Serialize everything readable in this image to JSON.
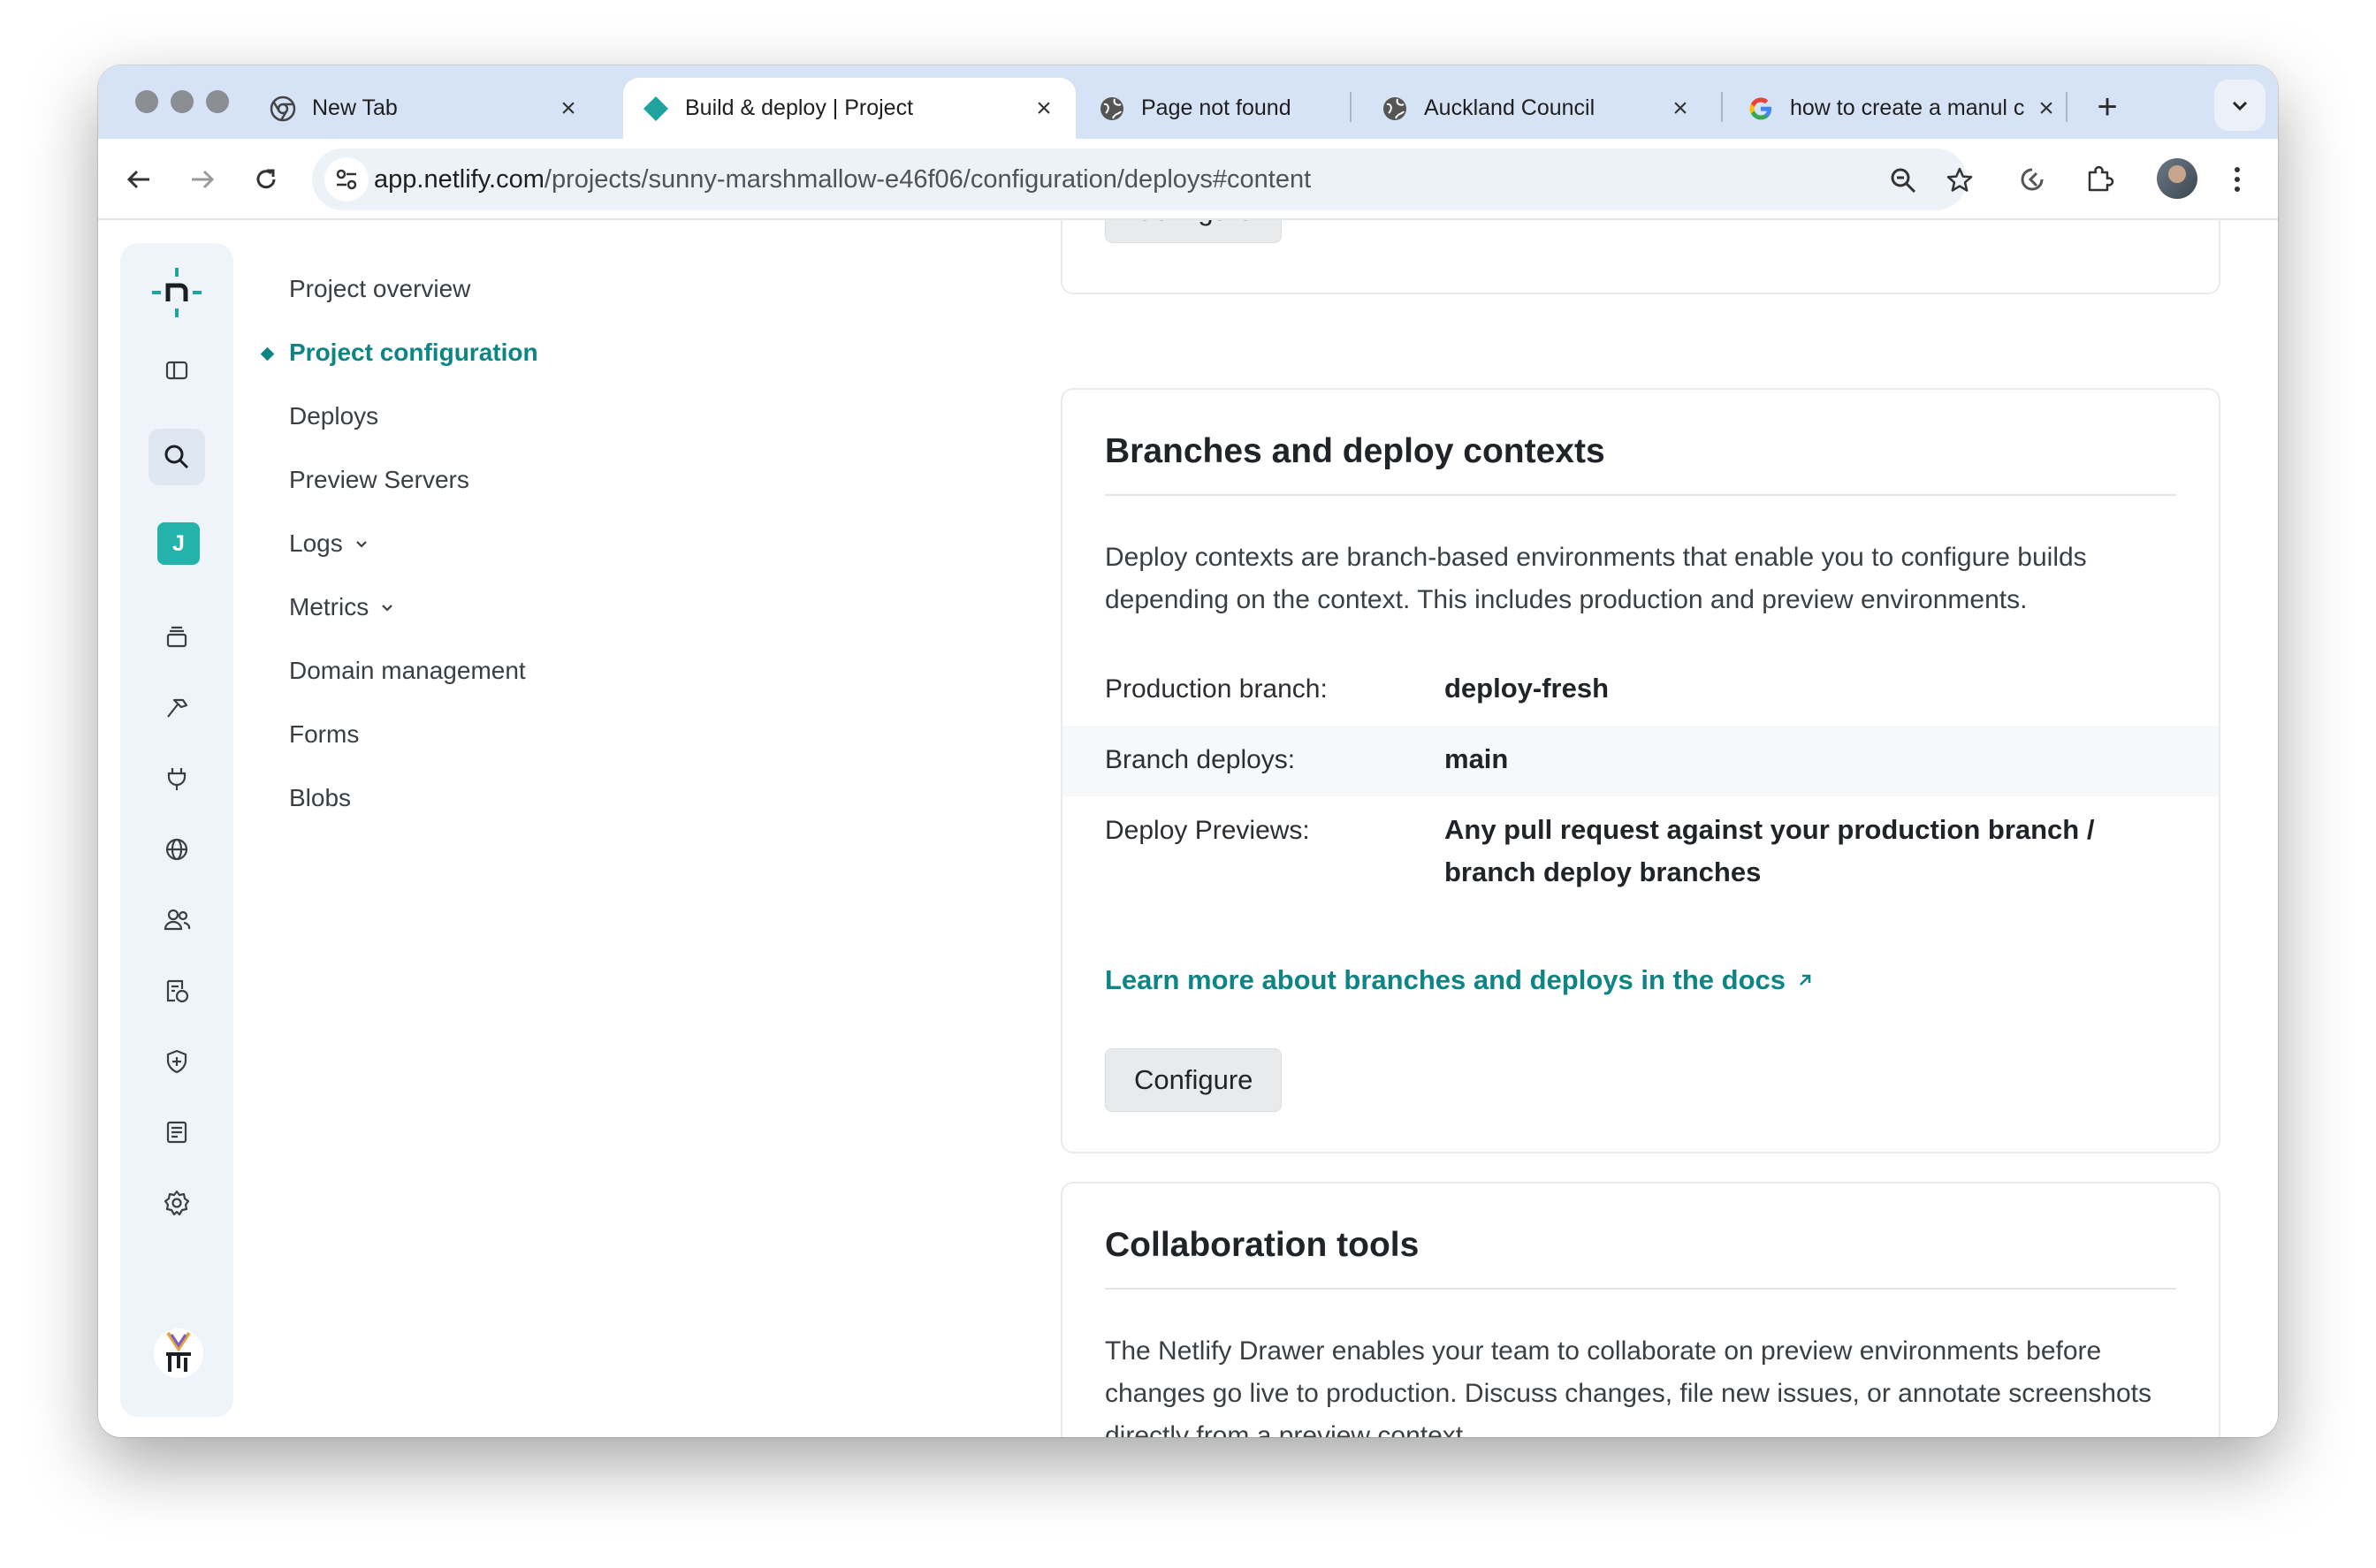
{
  "browser": {
    "tabs": [
      {
        "title": "New Tab",
        "icon": "chrome-icon",
        "active": false
      },
      {
        "title": "Build & deploy | Project",
        "icon": "netlify-icon",
        "active": true
      },
      {
        "title": "Page not found",
        "icon": "globe-icon",
        "active": false
      },
      {
        "title": "Auckland Council",
        "icon": "globe-icon",
        "active": false
      },
      {
        "title": "how to create a manul c",
        "icon": "google-icon",
        "active": false
      }
    ],
    "new_tab_label": "+",
    "url_host": "app.netlify.com",
    "url_path": "/projects/sunny-marshmallow-e46f06/configuration/deploys#content"
  },
  "rail": {
    "team_initial": "J"
  },
  "subnav": {
    "items": [
      {
        "label": "Project overview"
      },
      {
        "label": "Project configuration"
      },
      {
        "label": "Deploys"
      },
      {
        "label": "Preview Servers"
      },
      {
        "label": "Logs"
      },
      {
        "label": "Metrics"
      },
      {
        "label": "Domain management"
      },
      {
        "label": "Forms"
      },
      {
        "label": "Blobs"
      }
    ]
  },
  "prev_card": {
    "button_label": "Configure"
  },
  "branches_card": {
    "title": "Branches and deploy contexts",
    "description": "Deploy contexts are branch-based environments that enable you to configure builds depending on the context. This includes production and preview environments.",
    "rows": [
      {
        "key": "Production branch:",
        "value": "deploy-fresh"
      },
      {
        "key": "Branch deploys:",
        "value": "main"
      },
      {
        "key": "Deploy Previews:",
        "value": "Any pull request against your production branch / branch deploy branches"
      }
    ],
    "link_label": "Learn more about branches and deploys in the docs",
    "button_label": "Configure"
  },
  "collab_card": {
    "title": "Collaboration tools",
    "description": "The Netlify Drawer enables your team to collaborate on preview environments before changes go live to production. Discuss changes, file new issues, or annotate screenshots directly from a preview context."
  },
  "colors": {
    "accent": "#0d8585",
    "tabstrip": "#d6e3f6"
  }
}
